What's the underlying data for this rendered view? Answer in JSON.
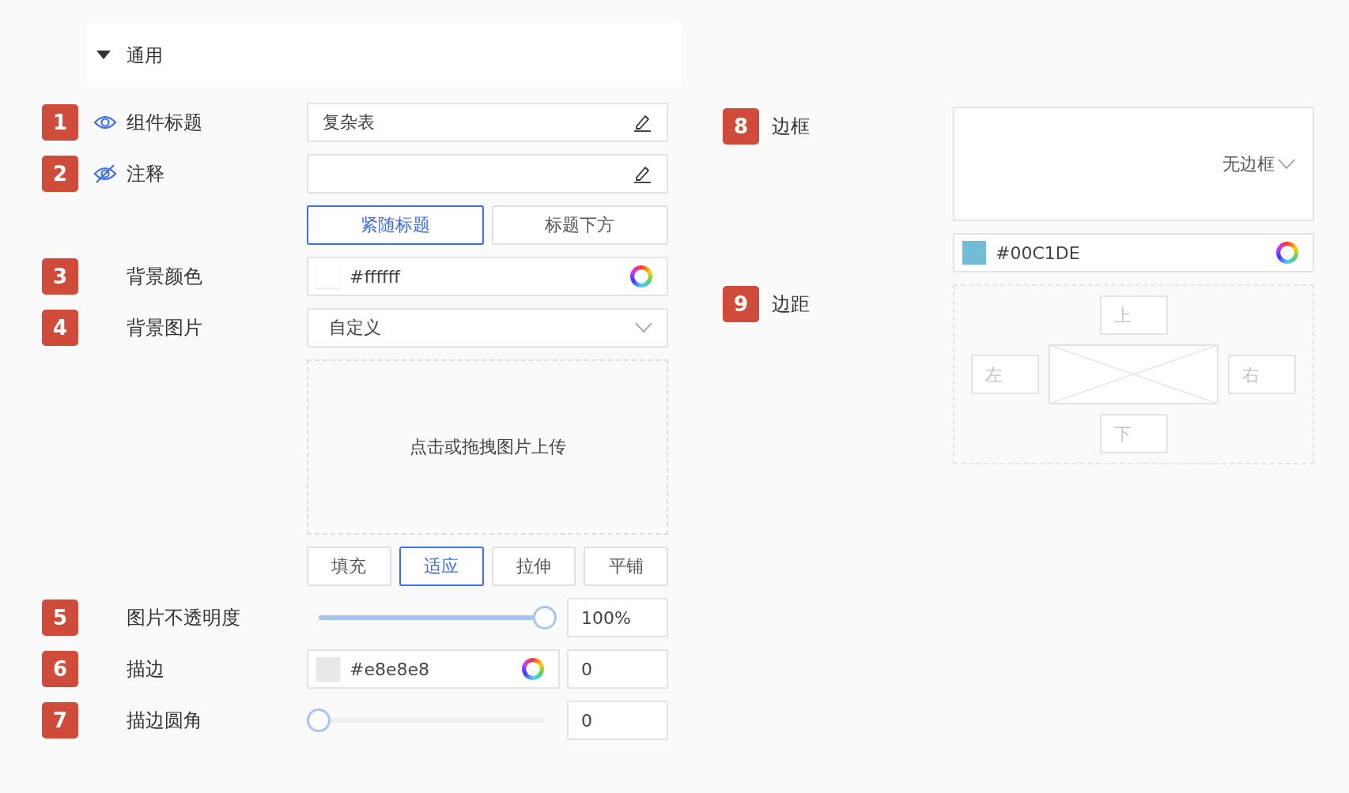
{
  "section": {
    "title": "通用",
    "expanded": true
  },
  "left_rows": [
    {
      "kind": "text",
      "number": "1",
      "label": "组件标题",
      "visible": true,
      "value": "复杂表"
    },
    {
      "kind": "text",
      "number": "2",
      "label": "注释",
      "visible": false
    },
    {
      "kind": "segmented",
      "options": [
        {
          "label": "紧随标题",
          "selected": true
        },
        {
          "label": "标题下方",
          "selected": false
        }
      ]
    },
    {
      "kind": "color",
      "number": "3",
      "label": "背景颜色",
      "value": "#ffffff",
      "color": "#ffffff"
    },
    {
      "kind": "select",
      "number": "4",
      "label": "背景图片",
      "value": "自定义"
    },
    {
      "kind": "upload",
      "text": "点击或拖拽图片上传"
    },
    {
      "kind": "segmented",
      "options": [
        {
          "label": "填充",
          "selected": false
        },
        {
          "label": "适应",
          "selected": true
        },
        {
          "label": "拉伸",
          "selected": false
        },
        {
          "label": "平铺",
          "selected": false
        }
      ]
    },
    {
      "kind": "slider",
      "number": "5",
      "label": "图片不透明度",
      "level": 1,
      "reading": "100%"
    },
    {
      "kind": "color_number",
      "number": "6",
      "label": "描边",
      "value": "#e8e8e8",
      "color": "#e8e8e8",
      "reading": "0"
    },
    {
      "kind": "slider",
      "number": "7",
      "label": "描边圆角",
      "level": 0,
      "reading": "0"
    }
  ],
  "right_rows": [
    {
      "kind": "border",
      "number": "8",
      "label": "边框",
      "value": "无边框",
      "color_value": "#00C1DE",
      "color": "#72bcd8"
    },
    {
      "kind": "margin",
      "number": "9",
      "label": "边距",
      "top": {
        "placeholder": "上"
      },
      "left": {
        "placeholder": "左"
      },
      "right": {
        "placeholder": "右"
      },
      "bottom": {
        "placeholder": "下"
      }
    }
  ]
}
